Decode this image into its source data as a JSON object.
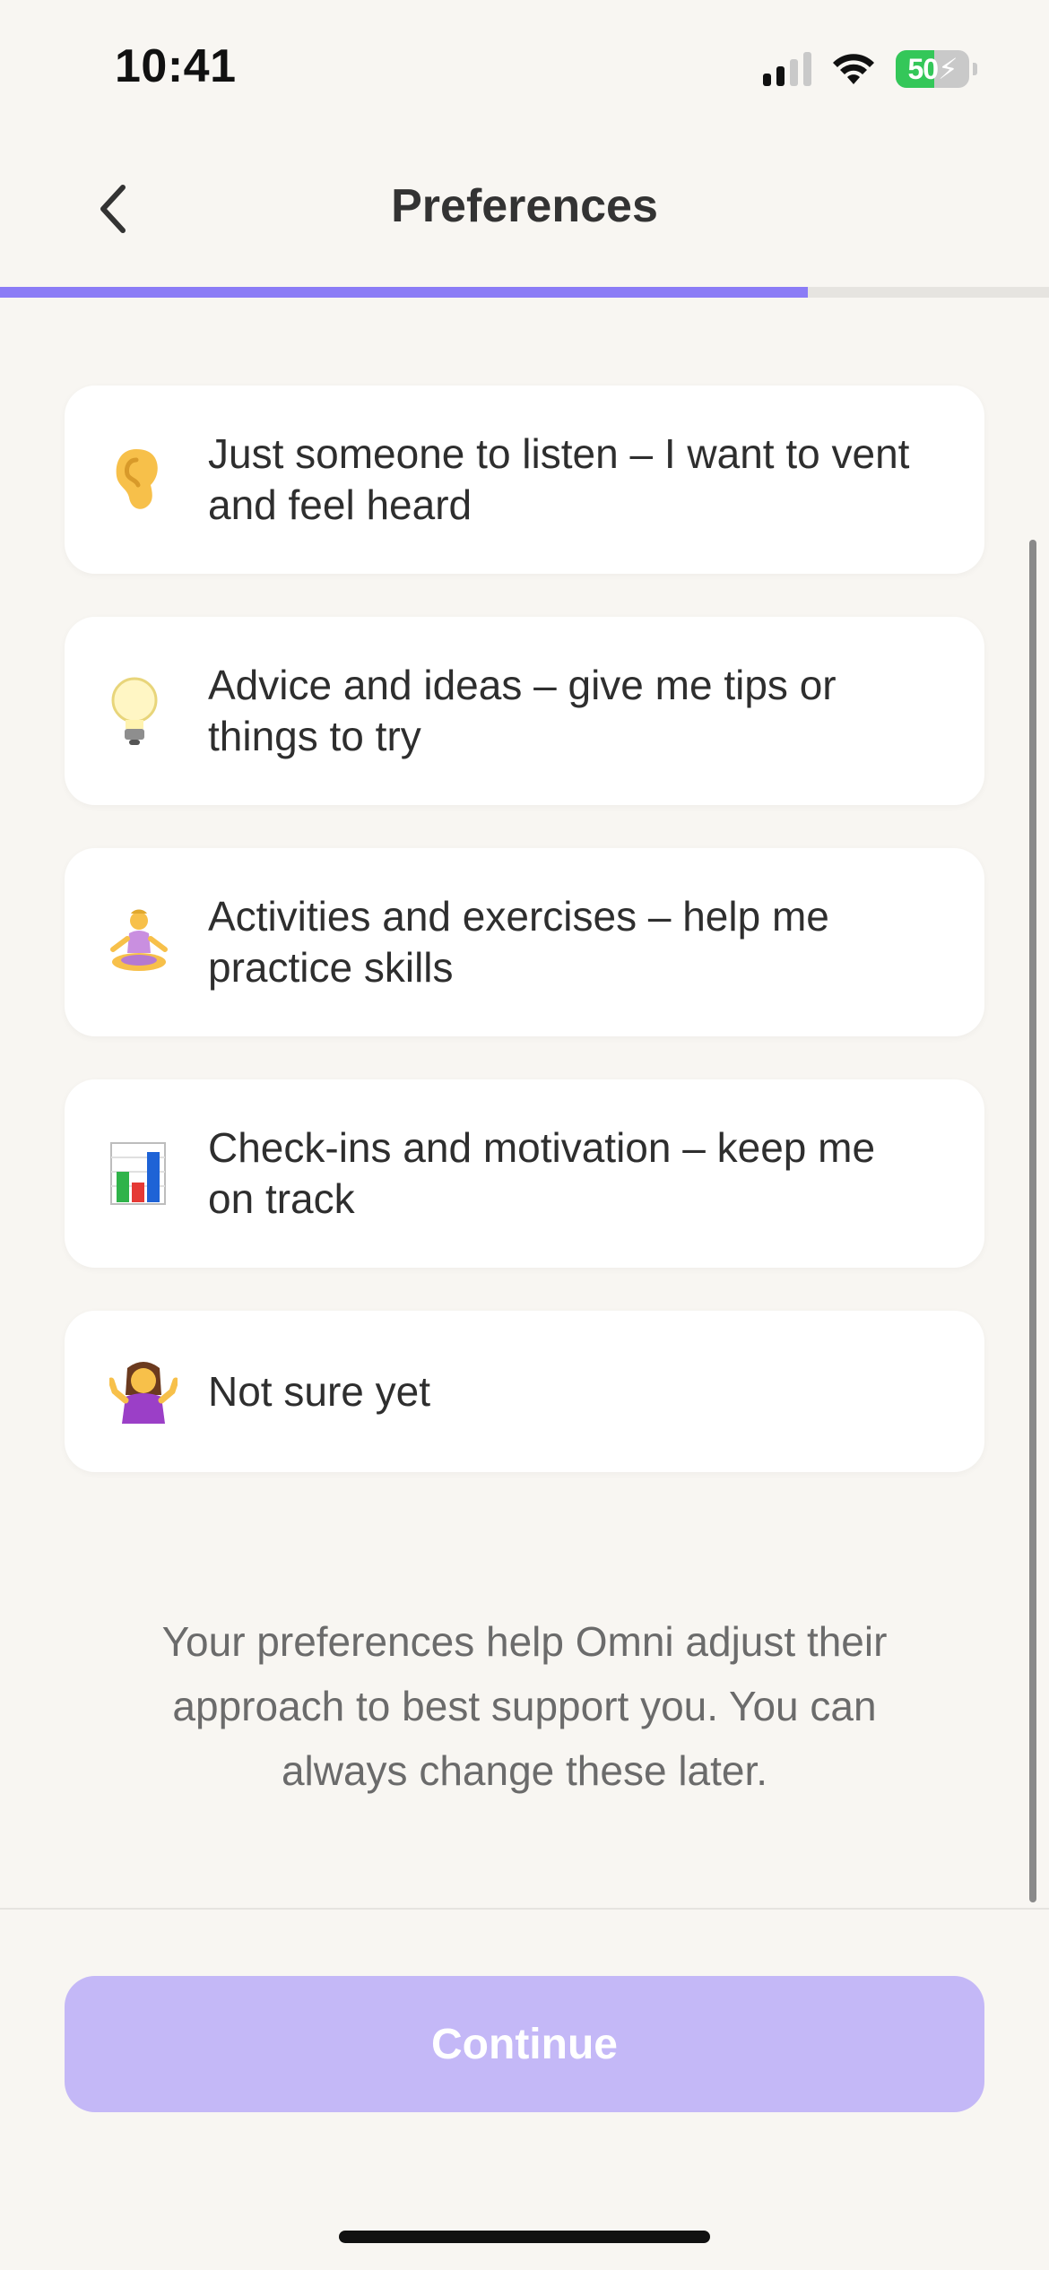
{
  "status_bar": {
    "time": "10:41",
    "battery_level": "50",
    "battery_charging": true,
    "signal_bars_active": 2,
    "signal_bars_total": 4
  },
  "header": {
    "title": "Preferences",
    "back_icon": "chevron-left-icon"
  },
  "progress": {
    "fraction": 0.77,
    "color": "#8b7cf6"
  },
  "options": [
    {
      "icon": "ear-icon",
      "label": "Just someone to listen – I want to vent and feel heard"
    },
    {
      "icon": "lightbulb-icon",
      "label": "Advice and ideas – give me tips or things to try"
    },
    {
      "icon": "meditation-icon",
      "label": "Activities and exercises – help me practice skills"
    },
    {
      "icon": "bar-chart-icon",
      "label": "Check-ins and motivation – keep me on track"
    },
    {
      "icon": "shrug-icon",
      "label": "Not sure yet"
    }
  ],
  "info_text": "Your preferences help Omni adjust their approach to best support you. You can always change these later.",
  "footer": {
    "continue_label": "Continue",
    "continue_color": "#c4b8f7"
  }
}
